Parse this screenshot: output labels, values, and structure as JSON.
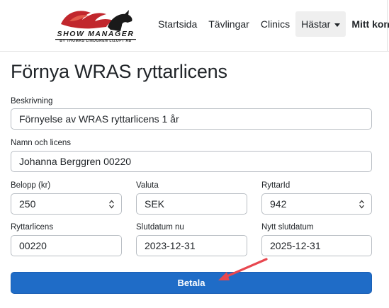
{
  "navbar": {
    "brand": "SHOW MANAGER",
    "brand_sub": "BY THOMAS LINDGREN LIZOFT AB",
    "items": [
      {
        "label": "Startsida"
      },
      {
        "label": "Tävlingar"
      },
      {
        "label": "Clinics"
      },
      {
        "label": "Hästar"
      },
      {
        "label": "Mitt konto"
      }
    ]
  },
  "page": {
    "title": "Förnya WRAS ryttarlicens"
  },
  "form": {
    "description": {
      "label": "Beskrivning",
      "value": "Förnyelse av WRAS ryttarlicens 1 år"
    },
    "name": {
      "label": "Namn och licens",
      "value": "Johanna Berggren 00220"
    },
    "amount": {
      "label": "Belopp (kr)",
      "value": "250"
    },
    "currency": {
      "label": "Valuta",
      "value": "SEK"
    },
    "rider_id": {
      "label": "RyttarId",
      "value": "942"
    },
    "license": {
      "label": "Ryttarlicens",
      "value": "00220"
    },
    "end_date": {
      "label": "Slutdatum nu",
      "value": "2023-12-31"
    },
    "new_end_date": {
      "label": "Nytt slutdatum",
      "value": "2025-12-31"
    },
    "pay_label": "Betala"
  },
  "colors": {
    "primary": "#1f6cc7",
    "annotation_arrow": "#e8474f",
    "logo_red": "#c1272d"
  }
}
